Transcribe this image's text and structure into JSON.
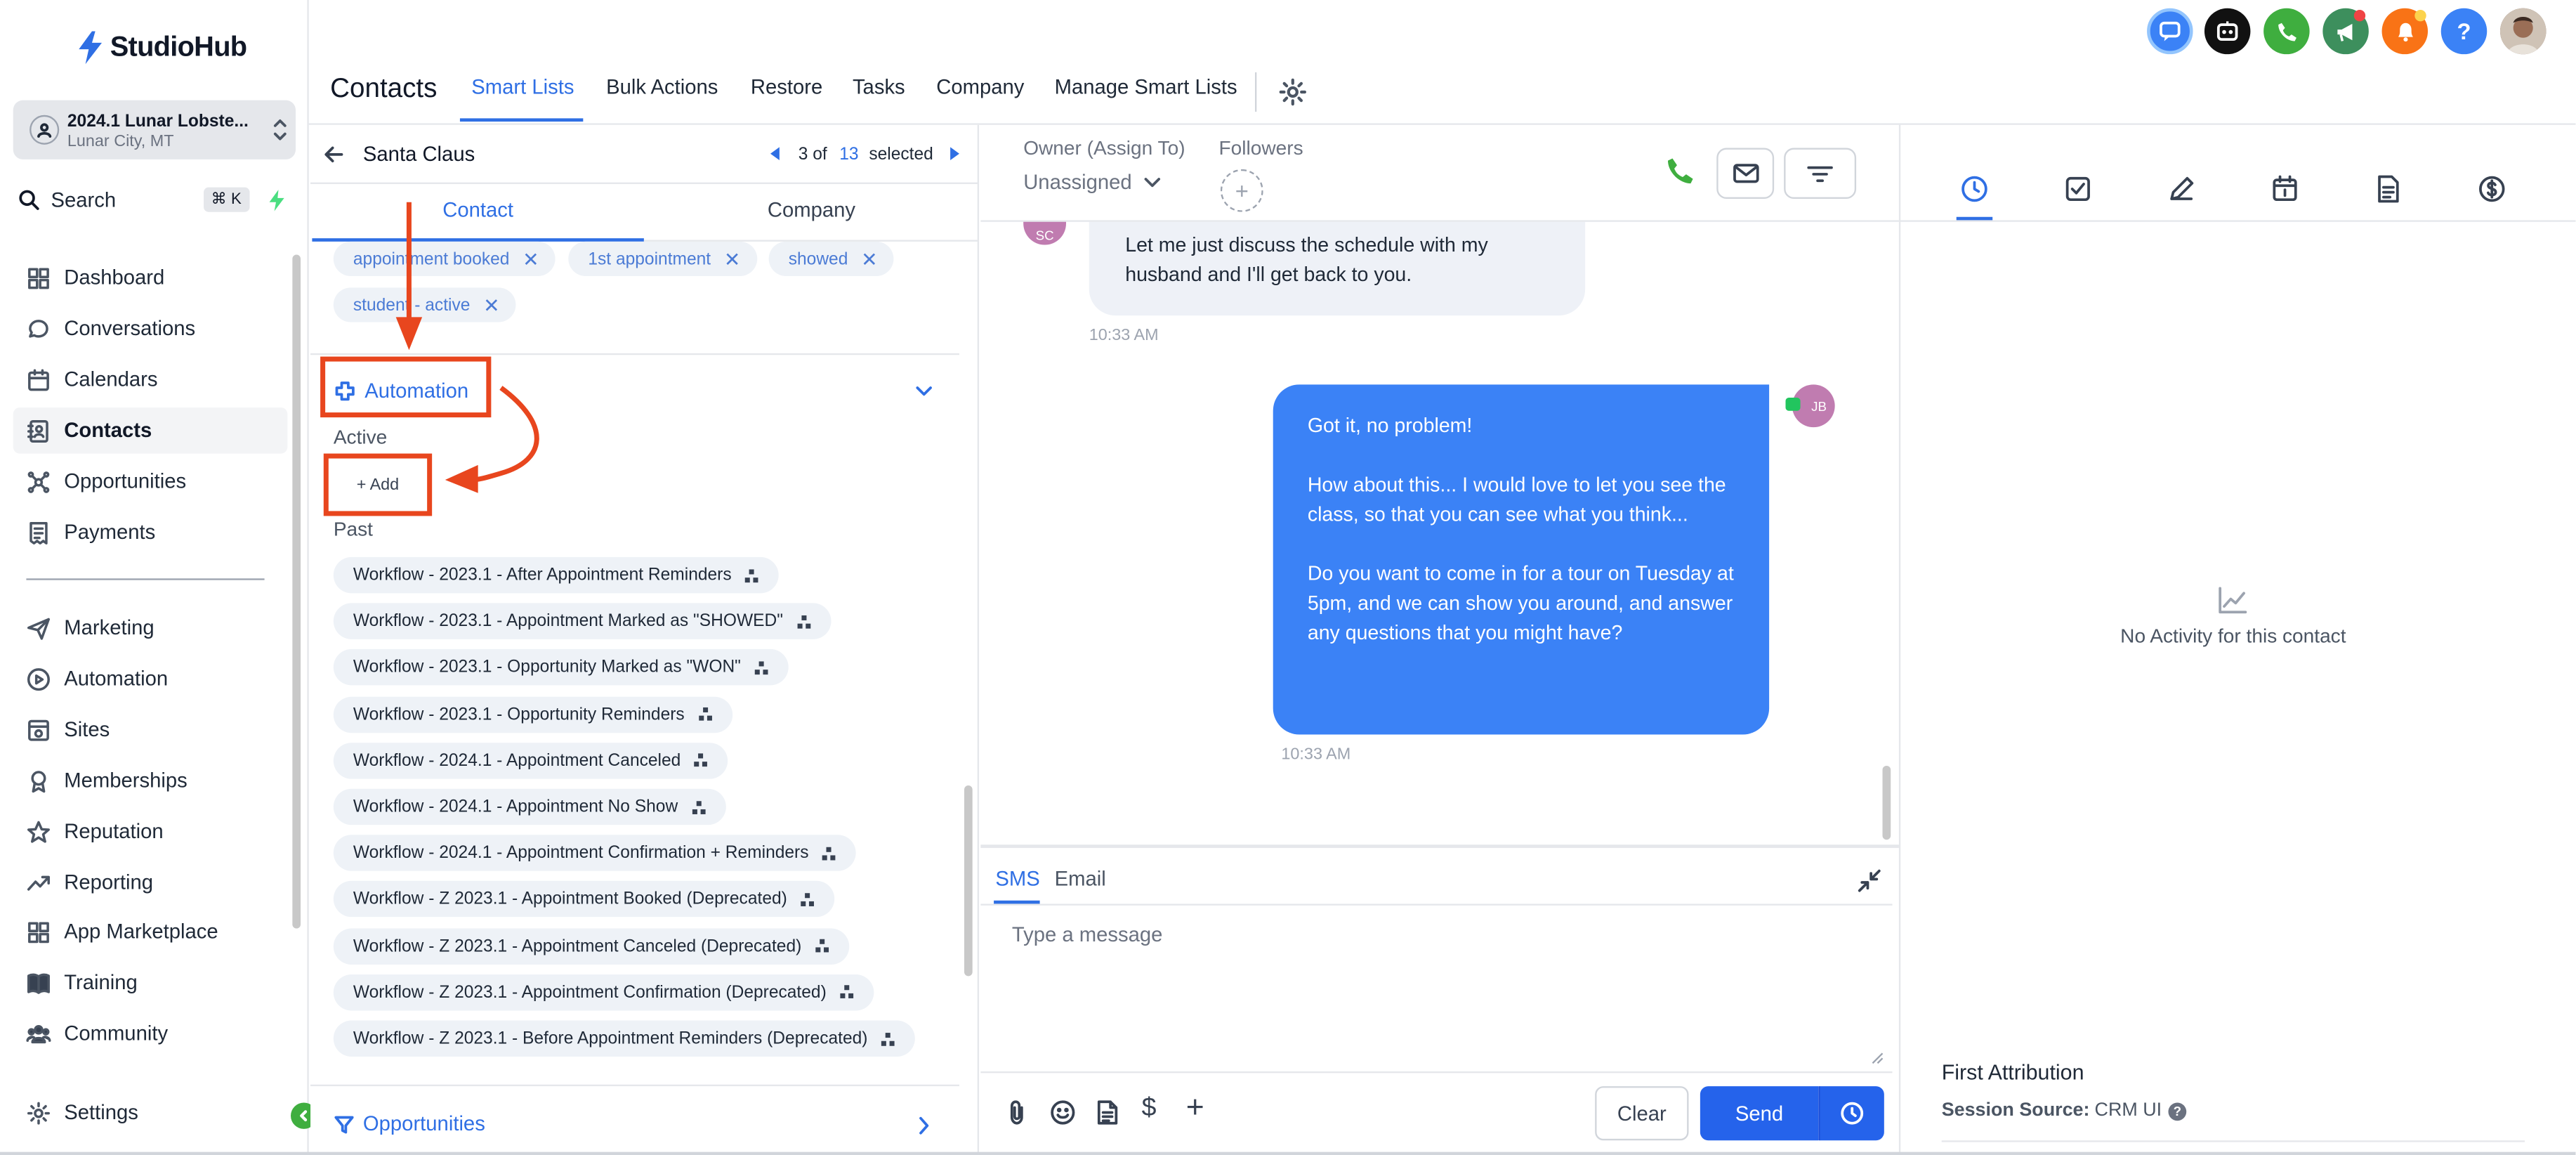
{
  "app": {
    "logo_text": "StudioHub"
  },
  "account": {
    "name": "2024.1 Lunar Lobste...",
    "location": "Lunar City, MT"
  },
  "search": {
    "label": "Search",
    "shortcut": "⌘ K"
  },
  "sidebar": {
    "items": [
      {
        "label": "Dashboard",
        "icon": "dashboard-icon"
      },
      {
        "label": "Conversations",
        "icon": "chat-icon"
      },
      {
        "label": "Calendars",
        "icon": "calendar-icon"
      },
      {
        "label": "Contacts",
        "icon": "contacts-icon",
        "active": true
      },
      {
        "label": "Opportunities",
        "icon": "opportunities-icon"
      },
      {
        "label": "Payments",
        "icon": "payments-icon"
      },
      {
        "label": "Marketing",
        "icon": "send-icon"
      },
      {
        "label": "Automation",
        "icon": "automation-icon"
      },
      {
        "label": "Sites",
        "icon": "sites-icon"
      },
      {
        "label": "Memberships",
        "icon": "memberships-icon"
      },
      {
        "label": "Reputation",
        "icon": "star-icon"
      },
      {
        "label": "Reporting",
        "icon": "reporting-icon"
      },
      {
        "label": "App Marketplace",
        "icon": "apps-icon"
      },
      {
        "label": "Training",
        "icon": "book-icon"
      },
      {
        "label": "Community",
        "icon": "community-icon"
      }
    ],
    "settings_label": "Settings"
  },
  "header": {
    "title": "Contacts",
    "tabs": [
      "Smart Lists",
      "Bulk Actions",
      "Restore",
      "Tasks",
      "Company",
      "Manage Smart Lists"
    ],
    "active_tab": "Smart Lists"
  },
  "contact_panel": {
    "name": "Santa Claus",
    "pager": {
      "current": "3 of",
      "total": "13",
      "suffix": "selected"
    },
    "tabs": [
      "Contact",
      "Company"
    ],
    "tags": [
      "appointment booked",
      "1st appointment",
      "showed",
      "student - active"
    ],
    "automation": {
      "title": "Automation",
      "active_label": "Active",
      "add_label": "+ Add",
      "past_label": "Past",
      "workflows": [
        "Workflow - 2023.1 - After Appointment Reminders",
        "Workflow - 2023.1 - Appointment Marked as \"SHOWED\"",
        "Workflow - 2023.1 - Opportunity Marked as \"WON\"",
        "Workflow - 2023.1 - Opportunity Reminders",
        "Workflow - 2024.1 - Appointment Canceled",
        "Workflow - 2024.1 - Appointment No Show",
        "Workflow - 2024.1 - Appointment  Confirmation + Reminders",
        "Workflow - Z 2023.1 - Appointment Booked (Deprecated)",
        "Workflow - Z 2023.1 - Appointment Canceled (Deprecated)",
        "Workflow - Z 2023.1 - Appointment Confirmation (Deprecated)",
        "Workflow - Z 2023.1 - Before Appointment Reminders (Deprecated)"
      ]
    },
    "opportunities_label": "Opportunities"
  },
  "conversation": {
    "owner_label": "Owner (Assign To)",
    "owner_value": "Unassigned",
    "followers_label": "Followers",
    "incoming": {
      "avatar": "SC",
      "text": "Let me just discuss the schedule with my husband and I'll get back to you.",
      "time": "10:33 AM"
    },
    "outgoing": {
      "avatar": "JB",
      "paragraphs": [
        "Got it, no problem!",
        "How about this... I would love to let you see the class, so that you can see what you think...",
        "Do you want to come in for a tour on Tuesday at 5pm, and we can show you around, and answer any questions that you might have?"
      ],
      "time": "10:33 AM"
    },
    "composer": {
      "tabs": [
        "SMS",
        "Email"
      ],
      "placeholder": "Type a message",
      "clear_label": "Clear",
      "send_label": "Send"
    }
  },
  "activity": {
    "empty_text": "No Activity for this contact",
    "attribution_title": "First Attribution",
    "session_source_label": "Session Source:",
    "session_source_value": "CRM UI"
  },
  "colors": {
    "accent": "#2f6fe4",
    "annotation": "#e8461e",
    "call_green": "#3fae3f",
    "bubble_blue": "#3b82f6"
  }
}
